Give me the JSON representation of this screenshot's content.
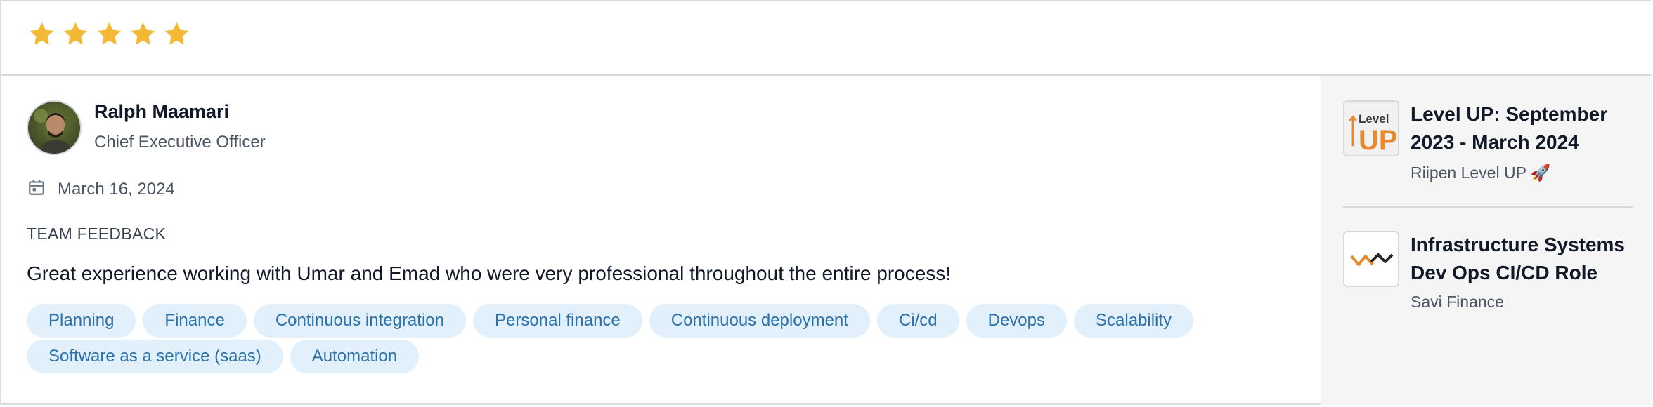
{
  "rating": {
    "value": 5,
    "max": 5,
    "star_color": "#f4b934"
  },
  "review": {
    "author_name": "Ralph Maamari",
    "author_title": "Chief Executive Officer",
    "date": "March 16, 2024",
    "section_heading": "TEAM FEEDBACK",
    "text": "Great experience working with Umar and Emad who were very professional throughout the entire process!",
    "tags": [
      "Planning",
      "Finance",
      "Continuous integration",
      "Personal finance",
      "Continuous deployment",
      "Ci/cd",
      "Devops",
      "Scalability",
      "Software as a service (saas)",
      "Automation"
    ]
  },
  "projects": [
    {
      "title": "Level UP: September 2023 - March 2024",
      "subtitle": "Riipen Level UP 🚀",
      "logo_text_top": "Level",
      "logo_text_main": "UP"
    },
    {
      "title": "Infrastructure Systems Dev Ops CI/CD Role",
      "subtitle": "Savi Finance",
      "logo": "savi-finance-logo"
    }
  ],
  "colors": {
    "tag_bg": "#e2f0fb",
    "tag_text": "#2c71aa",
    "sidebar_bg": "#f5f5f5",
    "levelup_orange": "#e8892b"
  }
}
